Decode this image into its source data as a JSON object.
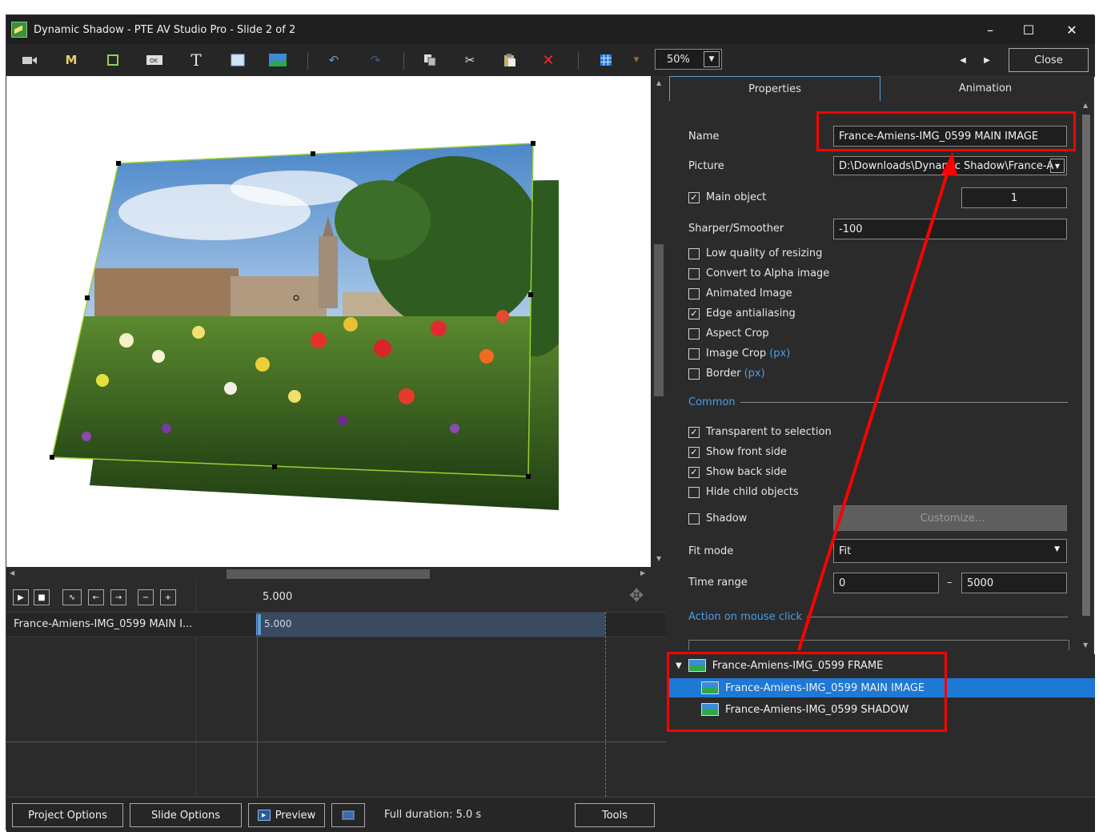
{
  "window": {
    "title": "Dynamic Shadow - PTE AV Studio Pro - Slide 2 of 2",
    "controls": [
      "–",
      "☐",
      "✕"
    ]
  },
  "toolbar": {
    "zoom": "50%",
    "close_label": "Close"
  },
  "tabs": [
    {
      "label": "Properties",
      "active": true
    },
    {
      "label": "Animation",
      "active": false
    }
  ],
  "properties": {
    "name_label": "Name",
    "name_value": "France-Amiens-IMG_0599 MAIN IMAGE",
    "picture_label": "Picture",
    "picture_value": "D:\\Downloads\\Dynamic Shadow\\France-A",
    "main_object_label": "Main object",
    "main_object_checked": true,
    "main_object_value": "1",
    "sharper_label": "Sharper/Smoother",
    "sharper_value": "-100",
    "checkboxes": [
      {
        "label": "Low quality of resizing",
        "checked": false
      },
      {
        "label": "Convert to Alpha image",
        "checked": false
      },
      {
        "label": "Animated Image",
        "checked": false
      },
      {
        "label": "Edge antialiasing",
        "checked": true
      },
      {
        "label": "Aspect Crop",
        "checked": false
      },
      {
        "label": "Image Crop",
        "checked": false,
        "suffix": "(px)"
      },
      {
        "label": "Border",
        "checked": false,
        "suffix": "(px)"
      }
    ],
    "common_label": "Common",
    "common_checkboxes": [
      {
        "label": "Transparent to selection",
        "checked": true
      },
      {
        "label": "Show front side",
        "checked": true
      },
      {
        "label": "Show back side",
        "checked": true
      },
      {
        "label": "Hide child objects",
        "checked": false
      }
    ],
    "shadow_label": "Shadow",
    "shadow_checked": false,
    "customize_label": "Customize...",
    "fit_mode_label": "Fit mode",
    "fit_mode_value": "Fit",
    "time_range_label": "Time range",
    "time_from": "0",
    "time_sep": "–",
    "time_to": "5000",
    "action_label": "Action on mouse click"
  },
  "tree": {
    "parent": "France-Amiens-IMG_0599 FRAME",
    "children": [
      {
        "label": "France-Amiens-IMG_0599 MAIN IMAGE",
        "selected": true
      },
      {
        "label": "France-Amiens-IMG_0599 SHADOW",
        "selected": false
      }
    ]
  },
  "timeline": {
    "ruler_time": "5.000",
    "track_label": "France-Amiens-IMG_0599 MAIN I...",
    "clip_time": "5.000"
  },
  "statusbar": {
    "project_options": "Project Options",
    "slide_options": "Slide Options",
    "preview": "Preview",
    "full_duration": "Full duration: 5.0 s",
    "tools": "Tools"
  },
  "colors": {
    "accent": "#1e78d6",
    "annotation": "#ff0000",
    "link_blue": "#4a9ee8",
    "selection_outline": "#9acd32"
  }
}
